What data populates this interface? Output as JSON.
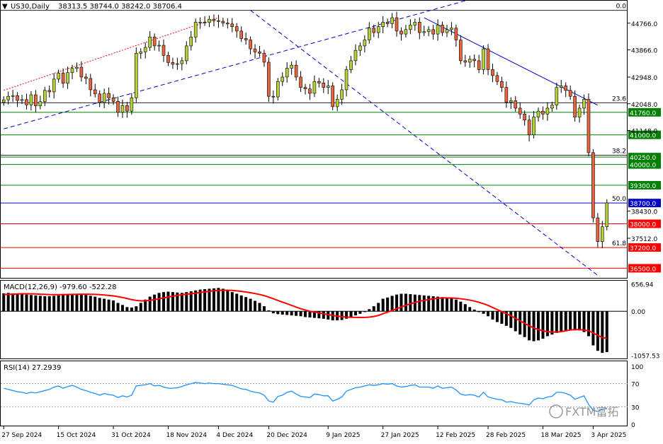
{
  "header": {
    "symbol": "US30,Daily",
    "ohlc": "38313.5 38744.0 38242.0 38706.4"
  },
  "colors": {
    "bull": "#b2d235",
    "bear": "#e8643c",
    "candle_outline": "#000000",
    "support_resistance": "#008000",
    "red_level": "#ff0000",
    "fib_line": "#000000",
    "blue_line": "#0000cc",
    "trend_dashed": "#0000cc",
    "trend_red_dotted": "#ff0000",
    "macd_signal": "#ff0000",
    "rsi_line": "#1e90ff"
  },
  "price_axis": {
    "ticks": [
      "44766.0",
      "43866.0",
      "42948.0",
      "42048.0",
      "41148.0",
      "38430.0",
      "37512.0"
    ]
  },
  "price_labels": [
    {
      "text": "41760.0",
      "value": 41760,
      "bg": "#008000"
    },
    {
      "text": "41000.0",
      "value": 41000,
      "bg": "#008000"
    },
    {
      "text": "40250.0",
      "value": 40250,
      "bg": "#008000"
    },
    {
      "text": "40000.0",
      "value": 40000,
      "bg": "#008000"
    },
    {
      "text": "39300.0",
      "value": 39300,
      "bg": "#008000"
    },
    {
      "text": "38700.0",
      "value": 38700,
      "bg": "#0000cc"
    },
    {
      "text": "38000.0",
      "value": 38000,
      "bg": "#ff0000"
    },
    {
      "text": "37200.0",
      "value": 37200,
      "bg": "#ff0000"
    },
    {
      "text": "36500.0",
      "value": 36500,
      "bg": "#ff0000"
    }
  ],
  "fib_levels": [
    {
      "text": "0.0",
      "value": 45200
    },
    {
      "text": "23.6",
      "value": 42080
    },
    {
      "text": "38.2",
      "value": 40310
    },
    {
      "text": "50.0",
      "value": 38700
    },
    {
      "text": "61.8",
      "value": 37200
    }
  ],
  "macd": {
    "label": "MACD(12,26,9) -979.60 -522.28",
    "ticks": [
      "656.94",
      "0.00",
      "-1057.53"
    ]
  },
  "rsi": {
    "label": "RSI(14) 27.2939",
    "ticks": [
      "100",
      "70",
      "30",
      "0"
    ]
  },
  "dates": [
    "27 Sep 2024",
    "15 Oct 2024",
    "31 Oct 2024",
    "18 Nov 2024",
    "4 Dec 2024",
    "20 Dec 2024",
    "9 Jan 2025",
    "27 Jan 2025",
    "12 Feb 2025",
    "28 Feb 2025",
    "18 Mar 2025",
    "3 Apr 2025"
  ],
  "watermark": "FXTM富拓",
  "chart_data": {
    "type": "candlestick",
    "symbol": "US30",
    "timeframe": "Daily",
    "ylim": [
      36200,
      45500
    ],
    "x": [
      "2024-09-26",
      "2024-09-27",
      "2024-09-30",
      "2024-10-01",
      "2024-10-02",
      "2024-10-03",
      "2024-10-04",
      "2024-10-07",
      "2024-10-08",
      "2024-10-09",
      "2024-10-10",
      "2024-10-11",
      "2024-10-14",
      "2024-10-15",
      "2024-10-16",
      "2024-10-17",
      "2024-10-18",
      "2024-10-21",
      "2024-10-22",
      "2024-10-23",
      "2024-10-24",
      "2024-10-25",
      "2024-10-28",
      "2024-10-29",
      "2024-10-30",
      "2024-10-31",
      "2024-11-01",
      "2024-11-04",
      "2024-11-05",
      "2024-11-06",
      "2024-11-07",
      "2024-11-08",
      "2024-11-11",
      "2024-11-12",
      "2024-11-13",
      "2024-11-14",
      "2024-11-15",
      "2024-11-18",
      "2024-11-19",
      "2024-11-20",
      "2024-11-21",
      "2024-11-22",
      "2024-11-25",
      "2024-11-26",
      "2024-11-27",
      "2024-11-29",
      "2024-12-02",
      "2024-12-03",
      "2024-12-04",
      "2024-12-05",
      "2024-12-06",
      "2024-12-09",
      "2024-12-10",
      "2024-12-11",
      "2024-12-12",
      "2024-12-13",
      "2024-12-16",
      "2024-12-17",
      "2024-12-18",
      "2024-12-19",
      "2024-12-20",
      "2024-12-23",
      "2024-12-24",
      "2024-12-26",
      "2024-12-27",
      "2024-12-30",
      "2024-12-31",
      "2025-01-02",
      "2025-01-03",
      "2025-01-06",
      "2025-01-07",
      "2025-01-08",
      "2025-01-10",
      "2025-01-13",
      "2025-01-14",
      "2025-01-15",
      "2025-01-16",
      "2025-01-17",
      "2025-01-21",
      "2025-01-22",
      "2025-01-23",
      "2025-01-24",
      "2025-01-27",
      "2025-01-28",
      "2025-01-29",
      "2025-01-30",
      "2025-01-31",
      "2025-02-03",
      "2025-02-04",
      "2025-02-05",
      "2025-02-06",
      "2025-02-07",
      "2025-02-10",
      "2025-02-11",
      "2025-02-12",
      "2025-02-13",
      "2025-02-14",
      "2025-02-18",
      "2025-02-19",
      "2025-02-20",
      "2025-02-21",
      "2025-02-24",
      "2025-02-25",
      "2025-02-26",
      "2025-02-27",
      "2025-02-28",
      "2025-03-03",
      "2025-03-04",
      "2025-03-05",
      "2025-03-06",
      "2025-03-07",
      "2025-03-10",
      "2025-03-11",
      "2025-03-12",
      "2025-03-13",
      "2025-03-14",
      "2025-03-17",
      "2025-03-18",
      "2025-03-19",
      "2025-03-20",
      "2025-03-21",
      "2025-03-24",
      "2025-03-25",
      "2025-03-26",
      "2025-03-27",
      "2025-03-28",
      "2025-03-31",
      "2025-04-01",
      "2025-04-02",
      "2025-04-03",
      "2025-04-04",
      "2025-04-07",
      "2025-04-08"
    ],
    "close": [
      42180,
      42300,
      42320,
      42160,
      42190,
      42010,
      42350,
      41980,
      42120,
      42500,
      42450,
      42880,
      43080,
      42740,
      43100,
      43240,
      43280,
      42950,
      42900,
      42520,
      42380,
      42090,
      42400,
      42250,
      42130,
      41760,
      41990,
      41800,
      42250,
      43750,
      43800,
      43950,
      44300,
      44000,
      44020,
      43680,
      43440,
      43380,
      43400,
      43500,
      44000,
      44300,
      44800,
      44800,
      44790,
      44900,
      44850,
      44830,
      44770,
      44740,
      44650,
      44500,
      44250,
      44200,
      43900,
      43800,
      43750,
      43450,
      42300,
      42280,
      42800,
      42950,
      43250,
      43350,
      42950,
      42600,
      42550,
      42400,
      42800,
      42750,
      42600,
      42650,
      41950,
      42200,
      42520,
      43200,
      43500,
      43850,
      44000,
      44200,
      44600,
      44450,
      44650,
      44800,
      44750,
      44950,
      44500,
      44400,
      44550,
      44700,
      44800,
      44450,
      44480,
      44550,
      44400,
      44700,
      44450,
      44550,
      44600,
      44200,
      43500,
      43450,
      43550,
      43500,
      43200,
      43900,
      43200,
      43000,
      42800,
      42600,
      42100,
      42150,
      41900,
      41700,
      41500,
      41000,
      41600,
      41800,
      41700,
      41900,
      42000,
      42600,
      42650,
      42500,
      42300,
      41600,
      41900,
      42200,
      40400,
      38200,
      37400,
      37900,
      38706
    ]
  },
  "indicator_data": {
    "macd_hist": [
      430,
      440,
      430,
      420,
      410,
      400,
      390,
      380,
      370,
      360,
      360,
      370,
      380,
      390,
      390,
      400,
      410,
      400,
      390,
      370,
      350,
      320,
      300,
      280,
      260,
      200,
      150,
      100,
      90,
      120,
      200,
      280,
      350,
      400,
      440,
      460,
      470,
      460,
      450,
      440,
      460,
      480,
      500,
      520,
      530,
      540,
      550,
      560,
      540,
      500,
      460,
      420,
      380,
      340,
      300,
      250,
      200,
      120,
      20,
      -50,
      -70,
      -80,
      -90,
      -100,
      -110,
      -120,
      -140,
      -150,
      -160,
      -170,
      -180,
      -200,
      -220,
      -220,
      -210,
      -180,
      -140,
      -100,
      -60,
      -20,
      50,
      120,
      200,
      300,
      330,
      370,
      400,
      420,
      420,
      410,
      400,
      390,
      380,
      370,
      360,
      350,
      340,
      330,
      310,
      280,
      230,
      170,
      100,
      40,
      -20,
      -60,
      -120,
      -200,
      -260,
      -300,
      -350,
      -400,
      -480,
      -560,
      -620,
      -700,
      -720,
      -700,
      -660,
      -600,
      -560,
      -520,
      -500,
      -480,
      -460,
      -460,
      -460,
      -500,
      -600,
      -820,
      -950,
      -1000,
      -980
    ],
    "macd_signal": [
      400,
      405,
      410,
      415,
      420,
      420,
      418,
      415,
      410,
      405,
      400,
      398,
      398,
      400,
      402,
      405,
      408,
      410,
      410,
      408,
      404,
      398,
      390,
      380,
      368,
      350,
      330,
      305,
      280,
      260,
      250,
      250,
      260,
      280,
      300,
      320,
      340,
      360,
      380,
      398,
      410,
      420,
      435,
      450,
      465,
      480,
      490,
      500,
      505,
      505,
      500,
      490,
      478,
      462,
      445,
      425,
      402,
      375,
      340,
      300,
      260,
      220,
      180,
      140,
      100,
      60,
      30,
      0,
      -20,
      -40,
      -60,
      -80,
      -100,
      -120,
      -130,
      -140,
      -145,
      -148,
      -150,
      -148,
      -140,
      -125,
      -100,
      -60,
      -20,
      20,
      60,
      100,
      140,
      180,
      210,
      240,
      260,
      280,
      300,
      310,
      320,
      320,
      318,
      312,
      300,
      285,
      268,
      245,
      215,
      180,
      140,
      90,
      40,
      -10,
      -60,
      -110,
      -170,
      -230,
      -290,
      -350,
      -400,
      -440,
      -470,
      -490,
      -500,
      -500,
      -490,
      -470,
      -450,
      -440,
      -440,
      -450,
      -470,
      -520,
      -580,
      -630,
      -650
    ],
    "rsi": [
      62,
      60,
      58,
      56,
      55,
      53,
      55,
      54,
      56,
      58,
      60,
      64,
      66,
      62,
      65,
      67,
      64,
      60,
      58,
      55,
      53,
      50,
      53,
      51,
      50,
      46,
      49,
      47,
      50,
      66,
      67,
      68,
      70,
      66,
      67,
      64,
      62,
      62,
      63,
      65,
      68,
      70,
      72,
      71,
      70,
      71,
      70,
      70,
      69,
      68,
      67,
      64,
      61,
      60,
      57,
      55,
      54,
      50,
      40,
      38,
      48,
      50,
      55,
      57,
      52,
      48,
      47,
      46,
      52,
      51,
      49,
      49,
      40,
      43,
      47,
      57,
      60,
      63,
      64,
      66,
      68,
      67,
      68,
      70,
      69,
      70,
      66,
      64,
      65,
      67,
      68,
      64,
      64,
      64,
      62,
      66,
      62,
      63,
      64,
      59,
      52,
      50,
      51,
      50,
      47,
      55,
      47,
      45,
      43,
      42,
      38,
      39,
      37,
      36,
      35,
      33,
      42,
      45,
      44,
      47,
      48,
      55,
      55,
      53,
      50,
      43,
      46,
      49,
      34,
      24,
      22,
      26,
      27
    ]
  }
}
